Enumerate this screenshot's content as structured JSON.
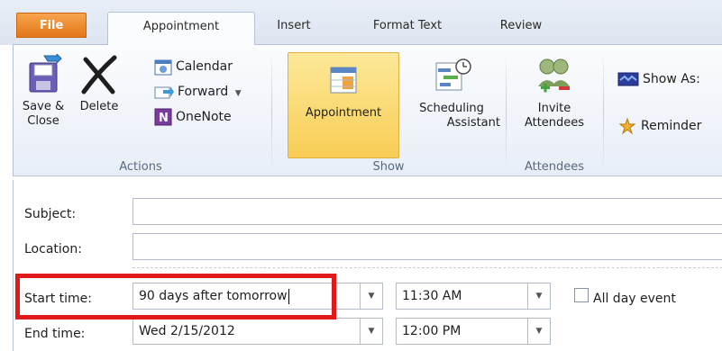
{
  "tabs": {
    "file": "File",
    "appointment": "Appointment",
    "insert": "Insert",
    "format_text": "Format Text",
    "review": "Review"
  },
  "ribbon": {
    "actions": {
      "label": "Actions",
      "save_close_line1": "Save &",
      "save_close_line2": "Close",
      "delete": "Delete",
      "calendar": "Calendar",
      "forward": "Forward",
      "onenote": "OneNote"
    },
    "show": {
      "label": "Show",
      "appointment": "Appointment",
      "scheduling_line1": "Scheduling",
      "scheduling_line2": "Assistant"
    },
    "attendees": {
      "label": "Attendees",
      "invite_line1": "Invite",
      "invite_line2": "Attendees"
    },
    "options": {
      "show_as": "Show As:",
      "reminder": "Reminder"
    }
  },
  "form": {
    "subject_label": "Subject:",
    "subject_value": "",
    "location_label": "Location:",
    "location_value": "",
    "start_label": "Start time:",
    "start_date": "90 days after tomorrow",
    "start_time": "11:30 AM",
    "all_day_label": "All day event",
    "all_day_checked": false,
    "end_label": "End time:",
    "end_date": "Wed 2/15/2012",
    "end_time": "12:00 PM"
  },
  "colors": {
    "file_tab": "#e2771a",
    "selected_button": "#f8cd55",
    "highlight_box": "#e0191b"
  }
}
